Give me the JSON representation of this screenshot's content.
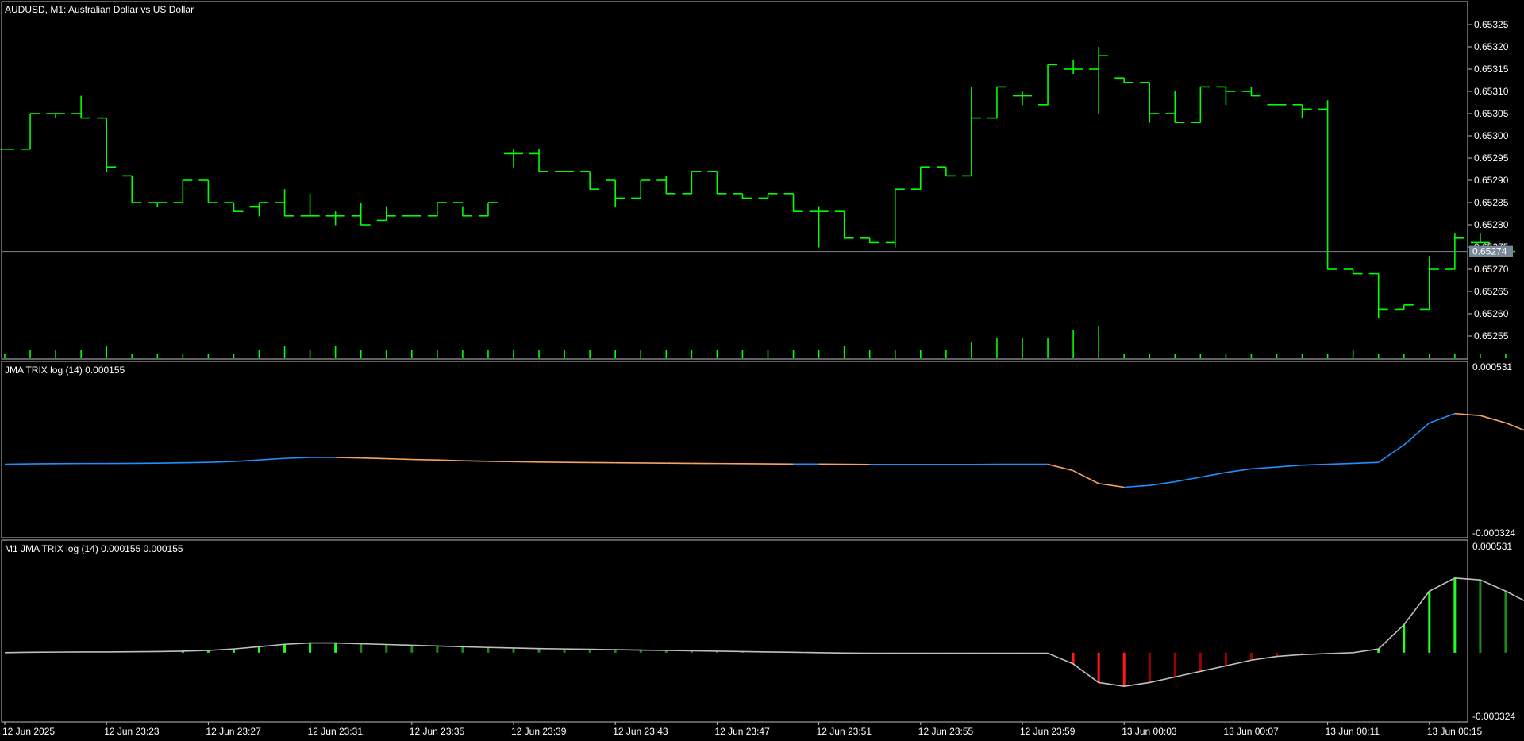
{
  "chart_data": [
    {
      "type": "ohlc",
      "title": "AUDUSD, M1:  Australian Dollar vs US Dollar",
      "ylim": [
        0.6525,
        0.6533
      ],
      "yticks": [
        "0.65325",
        "0.65320",
        "0.65315",
        "0.65310",
        "0.65305",
        "0.65300",
        "0.65295",
        "0.65290",
        "0.65285",
        "0.65280",
        "0.65275",
        "0.65270",
        "0.65265",
        "0.65260",
        "0.65255"
      ],
      "bid_line": 0.65274,
      "bid_label": "0.65274",
      "ohlc": [
        {
          "o": 0.65297,
          "h": 0.65297,
          "l": 0.65297,
          "c": 0.65297
        },
        {
          "o": 0.65297,
          "h": 0.65305,
          "l": 0.65297,
          "c": 0.65305
        },
        {
          "o": 0.65305,
          "h": 0.65305,
          "l": 0.65304,
          "c": 0.65305
        },
        {
          "o": 0.65305,
          "h": 0.65309,
          "l": 0.65304,
          "c": 0.65304
        },
        {
          "o": 0.65304,
          "h": 0.65304,
          "l": 0.65292,
          "c": 0.65293
        },
        {
          "o": 0.65291,
          "h": 0.65291,
          "l": 0.65285,
          "c": 0.65285
        },
        {
          "o": 0.65285,
          "h": 0.65285,
          "l": 0.65284,
          "c": 0.65285
        },
        {
          "o": 0.65285,
          "h": 0.6529,
          "l": 0.65285,
          "c": 0.6529
        },
        {
          "o": 0.6529,
          "h": 0.6529,
          "l": 0.65285,
          "c": 0.65285
        },
        {
          "o": 0.65285,
          "h": 0.65285,
          "l": 0.65283,
          "c": 0.65283
        },
        {
          "o": 0.65284,
          "h": 0.65285,
          "l": 0.65282,
          "c": 0.65285
        },
        {
          "o": 0.65285,
          "h": 0.65288,
          "l": 0.65282,
          "c": 0.65282
        },
        {
          "o": 0.65282,
          "h": 0.65287,
          "l": 0.65282,
          "c": 0.65282
        },
        {
          "o": 0.65282,
          "h": 0.65283,
          "l": 0.6528,
          "c": 0.65282
        },
        {
          "o": 0.65282,
          "h": 0.65285,
          "l": 0.6528,
          "c": 0.6528
        },
        {
          "o": 0.65281,
          "h": 0.65284,
          "l": 0.65281,
          "c": 0.65282
        },
        {
          "o": 0.65282,
          "h": 0.65282,
          "l": 0.65282,
          "c": 0.65282
        },
        {
          "o": 0.65282,
          "h": 0.65285,
          "l": 0.65282,
          "c": 0.65285
        },
        {
          "o": 0.65285,
          "h": 0.65284,
          "l": 0.65282,
          "c": 0.65282
        },
        {
          "o": 0.65282,
          "h": 0.65285,
          "l": 0.65282,
          "c": 0.65285
        },
        {
          "o": 0.65296,
          "h": 0.65297,
          "l": 0.65293,
          "c": 0.65296
        },
        {
          "o": 0.65296,
          "h": 0.65297,
          "l": 0.65292,
          "c": 0.65292
        },
        {
          "o": 0.65292,
          "h": 0.65292,
          "l": 0.65292,
          "c": 0.65292
        },
        {
          "o": 0.65292,
          "h": 0.65292,
          "l": 0.65288,
          "c": 0.65288
        },
        {
          "o": 0.6529,
          "h": 0.6529,
          "l": 0.65284,
          "c": 0.65286
        },
        {
          "o": 0.65286,
          "h": 0.6529,
          "l": 0.65286,
          "c": 0.6529
        },
        {
          "o": 0.6529,
          "h": 0.65291,
          "l": 0.65287,
          "c": 0.65287
        },
        {
          "o": 0.65287,
          "h": 0.65292,
          "l": 0.65287,
          "c": 0.65292
        },
        {
          "o": 0.65292,
          "h": 0.65292,
          "l": 0.65287,
          "c": 0.65287
        },
        {
          "o": 0.65287,
          "h": 0.65287,
          "l": 0.65286,
          "c": 0.65286
        },
        {
          "o": 0.65286,
          "h": 0.65287,
          "l": 0.65286,
          "c": 0.65287
        },
        {
          "o": 0.65287,
          "h": 0.65287,
          "l": 0.65283,
          "c": 0.65283
        },
        {
          "o": 0.65283,
          "h": 0.65284,
          "l": 0.65275,
          "c": 0.65283
        },
        {
          "o": 0.65283,
          "h": 0.65283,
          "l": 0.65277,
          "c": 0.65277
        },
        {
          "o": 0.65277,
          "h": 0.65277,
          "l": 0.65276,
          "c": 0.65276
        },
        {
          "o": 0.65276,
          "h": 0.65288,
          "l": 0.65275,
          "c": 0.65288
        },
        {
          "o": 0.65288,
          "h": 0.65293,
          "l": 0.65288,
          "c": 0.65293
        },
        {
          "o": 0.65293,
          "h": 0.65293,
          "l": 0.65291,
          "c": 0.65291
        },
        {
          "o": 0.65291,
          "h": 0.65311,
          "l": 0.65291,
          "c": 0.65304
        },
        {
          "o": 0.65304,
          "h": 0.65311,
          "l": 0.65304,
          "c": 0.65311
        },
        {
          "o": 0.65309,
          "h": 0.6531,
          "l": 0.65307,
          "c": 0.65309
        },
        {
          "o": 0.65307,
          "h": 0.65316,
          "l": 0.65307,
          "c": 0.65316
        },
        {
          "o": 0.65315,
          "h": 0.65317,
          "l": 0.65314,
          "c": 0.65315
        },
        {
          "o": 0.65315,
          "h": 0.6532,
          "l": 0.65305,
          "c": 0.65318
        },
        {
          "o": 0.65313,
          "h": 0.65313,
          "l": 0.65312,
          "c": 0.65312
        },
        {
          "o": 0.65312,
          "h": 0.65312,
          "l": 0.65303,
          "c": 0.65305
        },
        {
          "o": 0.65305,
          "h": 0.6531,
          "l": 0.65303,
          "c": 0.65303
        },
        {
          "o": 0.65303,
          "h": 0.65311,
          "l": 0.65303,
          "c": 0.65311
        },
        {
          "o": 0.65311,
          "h": 0.65311,
          "l": 0.65307,
          "c": 0.6531
        },
        {
          "o": 0.6531,
          "h": 0.65311,
          "l": 0.65309,
          "c": 0.65309
        },
        {
          "o": 0.65307,
          "h": 0.65307,
          "l": 0.65307,
          "c": 0.65307
        },
        {
          "o": 0.65307,
          "h": 0.65307,
          "l": 0.65304,
          "c": 0.65306
        },
        {
          "o": 0.65306,
          "h": 0.65308,
          "l": 0.6527,
          "c": 0.6527
        },
        {
          "o": 0.6527,
          "h": 0.6527,
          "l": 0.65269,
          "c": 0.65269
        },
        {
          "o": 0.65269,
          "h": 0.65269,
          "l": 0.65259,
          "c": 0.65261
        },
        {
          "o": 0.65261,
          "h": 0.65262,
          "l": 0.65261,
          "c": 0.65262
        },
        {
          "o": 0.65261,
          "h": 0.65273,
          "l": 0.65261,
          "c": 0.6527
        },
        {
          "o": 0.6527,
          "h": 0.65278,
          "l": 0.6527,
          "c": 0.65277
        },
        {
          "o": 0.65276,
          "h": 0.65278,
          "l": 0.65276,
          "c": 0.65276
        },
        {
          "o": 0.65275,
          "h": 0.65275,
          "l": 0.65274,
          "c": 0.65274
        }
      ],
      "volume_ticks": [
        1,
        2,
        2,
        2,
        3,
        1,
        1,
        1,
        1,
        1,
        2,
        3,
        2,
        3,
        2,
        2,
        2,
        2,
        2,
        2,
        2,
        2,
        2,
        2,
        2,
        2,
        2,
        2,
        2,
        2,
        2,
        2,
        2,
        3,
        2,
        2,
        2,
        2,
        4,
        5,
        5,
        5,
        7,
        8,
        1,
        1,
        1,
        1,
        1,
        1,
        1,
        1,
        1,
        2,
        1,
        1,
        1,
        1,
        1,
        1
      ]
    },
    {
      "type": "line",
      "title": "JMA TRIX log (14) 0.000155",
      "ylim": [
        -0.000324,
        0.000531
      ],
      "ytick_labels": [
        "0.000531",
        "-0.000324"
      ],
      "colors": {
        "up": "#1e90ff",
        "down": "#f4a460"
      },
      "values": [
        4.5e-05,
        4.7e-05,
        4.8e-05,
        4.9e-05,
        4.9e-05,
        5e-05,
        5.1e-05,
        5.3e-05,
        5.5e-05,
        6e-05,
        6.8e-05,
        7.7e-05,
        8.2e-05,
        8.2e-05,
        7.9e-05,
        7.5e-05,
        7.1e-05,
        6.8e-05,
        6.4e-05,
        6.1e-05,
        5.9e-05,
        5.7e-05,
        5.5e-05,
        5.4e-05,
        5.3e-05,
        5.2e-05,
        5.1e-05,
        5e-05,
        4.9e-05,
        4.8e-05,
        4.7e-05,
        4.6e-05,
        4.6e-05,
        4.5e-05,
        4.4e-05,
        4.4e-05,
        4.4e-05,
        4.4e-05,
        4.4e-05,
        4.5e-05,
        4.5e-05,
        4.5e-05,
        1e-05,
        -6e-05,
        -8e-05,
        -7e-05,
        -5e-05,
        -2.5e-05,
        0.0,
        2e-05,
        3e-05,
        4e-05,
        4.5e-05,
        5e-05,
        5.5e-05,
        0.00015,
        0.00027,
        0.000321,
        0.00031,
        0.00027,
        0.000215,
        0.000155
      ]
    },
    {
      "type": "histogram",
      "title": "M1 JMA TRIX log (14) 0.000155 0.000155",
      "ylim": [
        -0.000324,
        0.000531
      ],
      "ytick_labels": [
        "0.000531",
        "-0.000324"
      ],
      "line_color": "#c0c0c0",
      "bar_colors": {
        "up_strong": "#22ff22",
        "up_weak": "#1a8c1a",
        "down_strong": "#ff1a1a",
        "down_weak": "#a00000"
      },
      "values": [
        0.0,
        2e-06,
        3e-06,
        4e-06,
        4e-06,
        5e-06,
        6e-06,
        8e-06,
        1.2e-05,
        2e-05,
        3.2e-05,
        4.5e-05,
        5.2e-05,
        5.2e-05,
        4.8e-05,
        4.4e-05,
        4e-05,
        3.6e-05,
        3.2e-05,
        2.8e-05,
        2.5e-05,
        2.2e-05,
        2e-05,
        1.8e-05,
        1.6e-05,
        1.4e-05,
        1.2e-05,
        1e-05,
        8e-06,
        6e-06,
        4e-06,
        2e-06,
        0.0,
        -2e-06,
        -3e-06,
        -3e-06,
        -3e-06,
        -3e-06,
        -3e-06,
        -3e-06,
        -3e-06,
        -3e-06,
        -6e-05,
        -0.00016,
        -0.00018,
        -0.00016,
        -0.00013,
        -0.0001,
        -7e-05,
        -4e-05,
        -2e-05,
        -1e-05,
        -5e-06,
        0.0,
        2e-05,
        0.00015,
        0.00033,
        0.0004,
        0.00039,
        0.00033,
        0.00026,
        0.000155
      ]
    }
  ],
  "x_axis": {
    "labels": [
      "12 Jun 2025",
      "12 Jun 23:23",
      "12 Jun 23:27",
      "12 Jun 23:31",
      "12 Jun 23:35",
      "12 Jun 23:39",
      "12 Jun 23:43",
      "12 Jun 23:47",
      "12 Jun 23:51",
      "12 Jun 23:55",
      "12 Jun 23:59",
      "13 Jun 00:03",
      "13 Jun 00:07",
      "13 Jun 00:11",
      "13 Jun 00:15"
    ]
  },
  "colors": {
    "background": "#000000",
    "bar": "#00ff00",
    "grid_border": "#c0c0c0",
    "bid_line": "#778899",
    "bid_label_bg": "#778899"
  }
}
